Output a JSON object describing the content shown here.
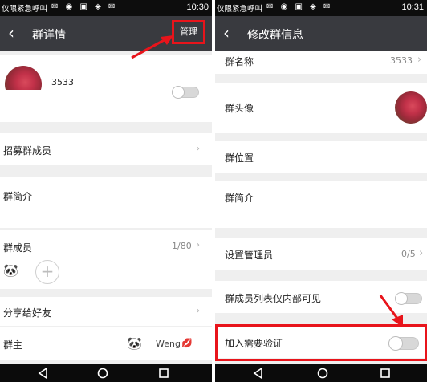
{
  "status": {
    "carrier": "仅限紧急呼叫",
    "left_time": "10:30",
    "right_time": "10:31"
  },
  "left_screen": {
    "title": "群详情",
    "manage_label": "管理",
    "group_name": "3533",
    "rows": {
      "recruit": "招募群成员",
      "intro": "群简介",
      "members": "群成员",
      "members_count": "1/80",
      "share": "分享给好友",
      "owner": "群主",
      "owner_name": "Weng"
    }
  },
  "right_screen": {
    "title": "修改群信息",
    "rows": {
      "group_name_label": "群名称",
      "group_name_value": "3533",
      "avatar_label": "群头像",
      "location_label": "群位置",
      "intro_label": "群简介",
      "admin_label": "设置管理员",
      "admin_count": "0/5",
      "member_list_label": "群成员列表仅内部可见",
      "verify_label": "加入需要验证"
    }
  },
  "icons": {
    "back": "back-arrow-icon",
    "chevron": "chevron-right-icon",
    "add": "plus-icon",
    "nav_back": "triangle-back-icon",
    "nav_home": "circle-home-icon",
    "nav_recent": "square-recent-icon"
  },
  "colors": {
    "appbar": "#393a3f",
    "highlight": "#e8141b",
    "background": "#efefef"
  }
}
